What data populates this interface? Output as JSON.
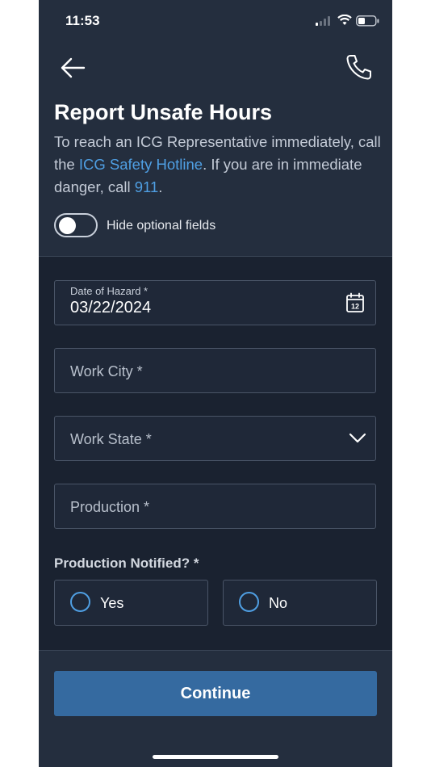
{
  "status_bar": {
    "time": "11:53"
  },
  "header": {
    "back_icon": "arrow-left-icon",
    "call_icon": "phone-icon"
  },
  "page": {
    "title": "Report Unsafe Hours",
    "desc_part1": "To reach an ICG Representative immediately, call the ",
    "hotline_link": "ICG Safety Hotline",
    "desc_part2": ". If you are in immediate danger, call ",
    "emergency_link": "911",
    "desc_part3": "."
  },
  "toggle": {
    "label": "Hide optional fields",
    "on": false
  },
  "form": {
    "date": {
      "label": "Date of Hazard *",
      "value": "03/22/2024",
      "icon": "calendar-icon",
      "icon_text": "12"
    },
    "work_city": {
      "placeholder": "Work City *"
    },
    "work_state": {
      "placeholder": "Work State *",
      "icon": "chevron-down-icon"
    },
    "production": {
      "placeholder": "Production *"
    },
    "production_notified": {
      "label": "Production Notified? *",
      "options": [
        "Yes",
        "No"
      ]
    }
  },
  "footer": {
    "continue_label": "Continue"
  },
  "colors": {
    "accent": "#4f9fe3",
    "button": "#356aa0",
    "background": "#1a2230",
    "header": "#242e3e"
  }
}
